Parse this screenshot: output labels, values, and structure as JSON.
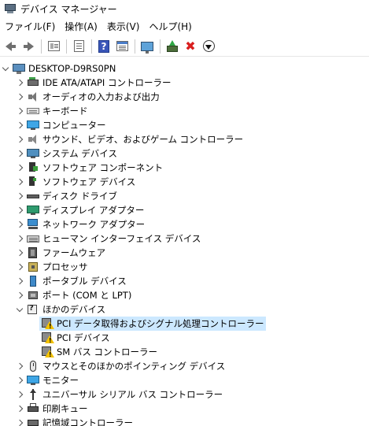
{
  "window": {
    "title": "デバイス マネージャー"
  },
  "menu": [
    "ファイル(F)",
    "操作(A)",
    "表示(V)",
    "ヘルプ(H)"
  ],
  "toolbar": {
    "buttons": [
      "back",
      "forward",
      "show-hide-console-tree",
      "properties",
      "help",
      "view",
      "scan-hardware",
      "update-driver",
      "uninstall-device",
      "disable-device"
    ],
    "icons": [
      "arrow-left-icon",
      "arrow-right-icon",
      "console-tree-icon",
      "properties-icon",
      "help-icon",
      "view-icon",
      "scan-icon",
      "update-driver-icon",
      "delete-icon",
      "disable-icon"
    ]
  },
  "tree": {
    "root": {
      "label": "DESKTOP-D9RS0PN",
      "icon": "computer-icon",
      "expanded": true
    },
    "categories": [
      {
        "label": "IDE ATA/ATAPI コントローラー",
        "icon": "ide-controller-icon",
        "expanded": false
      },
      {
        "label": "オーディオの入力および出力",
        "icon": "audio-icon",
        "expanded": false
      },
      {
        "label": "キーボード",
        "icon": "keyboard-icon",
        "expanded": false
      },
      {
        "label": "コンピューター",
        "icon": "computer-icon",
        "expanded": false
      },
      {
        "label": "サウンド、ビデオ、およびゲーム コントローラー",
        "icon": "sound-icon",
        "expanded": false
      },
      {
        "label": "システム デバイス",
        "icon": "system-device-icon",
        "expanded": false
      },
      {
        "label": "ソフトウェア コンポーネント",
        "icon": "software-component-icon",
        "expanded": false
      },
      {
        "label": "ソフトウェア デバイス",
        "icon": "software-device-icon",
        "expanded": false
      },
      {
        "label": "ディスク ドライブ",
        "icon": "disk-drive-icon",
        "expanded": false
      },
      {
        "label": "ディスプレイ アダプター",
        "icon": "display-adapter-icon",
        "expanded": false
      },
      {
        "label": "ネットワーク アダプター",
        "icon": "network-adapter-icon",
        "expanded": false
      },
      {
        "label": "ヒューマン インターフェイス デバイス",
        "icon": "hid-icon",
        "expanded": false
      },
      {
        "label": "ファームウェア",
        "icon": "firmware-icon",
        "expanded": false
      },
      {
        "label": "プロセッサ",
        "icon": "processor-icon",
        "expanded": false
      },
      {
        "label": "ポータブル デバイス",
        "icon": "portable-device-icon",
        "expanded": false
      },
      {
        "label": "ポート (COM と LPT)",
        "icon": "port-icon",
        "expanded": false
      },
      {
        "label": "ほかのデバイス",
        "icon": "other-device-icon",
        "expanded": true
      },
      {
        "label": "マウスとそのほかのポインティング デバイス",
        "icon": "mouse-icon",
        "expanded": false
      },
      {
        "label": "モニター",
        "icon": "monitor-icon",
        "expanded": false
      },
      {
        "label": "ユニバーサル シリアル バス コントローラー",
        "icon": "usb-icon",
        "expanded": false
      },
      {
        "label": "印刷キュー",
        "icon": "print-queue-icon",
        "expanded": false
      },
      {
        "label": "記憶域コントローラー",
        "icon": "storage-controller-icon",
        "expanded": false
      }
    ],
    "other_devices": [
      {
        "label": "PCI データ取得およびシグナル処理コントローラー",
        "icon": "warning-device-icon",
        "selected": true
      },
      {
        "label": "PCI デバイス",
        "icon": "warning-device-icon",
        "selected": false
      },
      {
        "label": "SM バス コントローラー",
        "icon": "warning-device-icon",
        "selected": false
      }
    ]
  },
  "colors": {
    "selection": "#cce8ff",
    "warning": "#f2c100",
    "delete": "#d91e1e"
  }
}
